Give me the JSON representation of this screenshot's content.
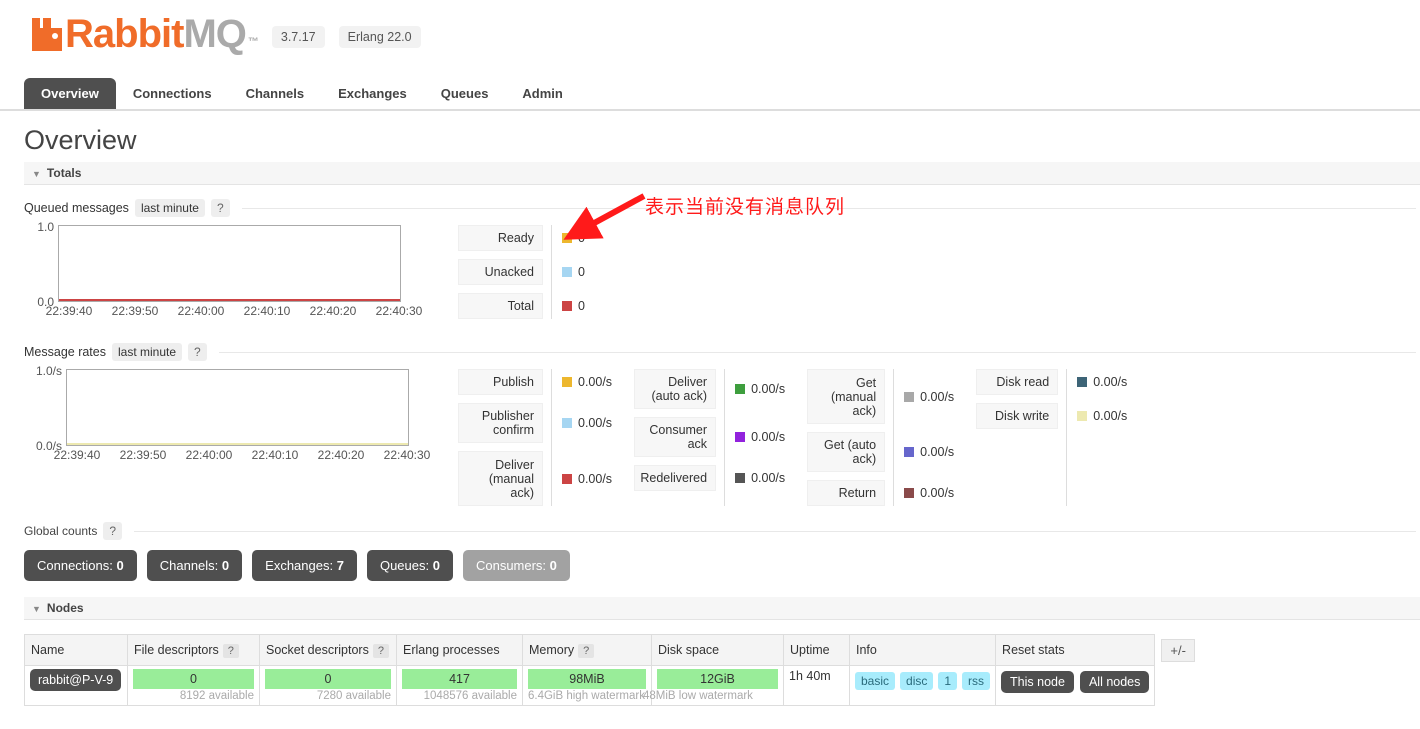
{
  "header": {
    "logo_rabbit": "Rabbit",
    "logo_mq": "MQ",
    "trademark": "™",
    "version": "3.7.17",
    "erlang": "Erlang 22.0"
  },
  "nav": {
    "tabs": [
      {
        "label": "Overview",
        "active": true
      },
      {
        "label": "Connections",
        "active": false
      },
      {
        "label": "Channels",
        "active": false
      },
      {
        "label": "Exchanges",
        "active": false
      },
      {
        "label": "Queues",
        "active": false
      },
      {
        "label": "Admin",
        "active": false
      }
    ]
  },
  "page": {
    "title": "Overview"
  },
  "totals": {
    "section_label": "Totals",
    "queued": {
      "label": "Queued messages",
      "period": "last minute",
      "help": "?",
      "y_top": "1.0",
      "y_bottom": "0.0",
      "x_ticks": [
        "22:39:40",
        "22:39:50",
        "22:40:00",
        "22:40:10",
        "22:40:20",
        "22:40:30"
      ],
      "legend": [
        {
          "name": "Ready",
          "value": "0",
          "color": "#edb72e"
        },
        {
          "name": "Unacked",
          "value": "0",
          "color": "#a6d6f2"
        },
        {
          "name": "Total",
          "value": "0",
          "color": "#cc4444"
        }
      ]
    },
    "rates": {
      "label": "Message rates",
      "period": "last minute",
      "help": "?",
      "y_top": "1.0/s",
      "y_bottom": "0.0/s",
      "x_ticks": [
        "22:39:40",
        "22:39:50",
        "22:40:00",
        "22:40:10",
        "22:40:20",
        "22:40:30"
      ],
      "groups": [
        [
          {
            "name": "Publish",
            "value": "0.00/s",
            "color": "#edb72e"
          },
          {
            "name": "Publisher confirm",
            "value": "0.00/s",
            "color": "#a6d6f2"
          },
          {
            "name": "Deliver (manual ack)",
            "value": "0.00/s",
            "color": "#cc4444"
          }
        ],
        [
          {
            "name": "Deliver (auto ack)",
            "value": "0.00/s",
            "color": "#3e9e3e"
          },
          {
            "name": "Consumer ack",
            "value": "0.00/s",
            "color": "#9222dd"
          },
          {
            "name": "Redelivered",
            "value": "0.00/s",
            "color": "#555555"
          }
        ],
        [
          {
            "name": "Get (manual ack)",
            "value": "0.00/s",
            "color": "#a8a8a8"
          },
          {
            "name": "Get (auto ack)",
            "value": "0.00/s",
            "color": "#6666cc"
          },
          {
            "name": "Return",
            "value": "0.00/s",
            "color": "#8a4a4a"
          }
        ],
        [
          {
            "name": "Disk read",
            "value": "0.00/s",
            "color": "#3d6477"
          },
          {
            "name": "Disk write",
            "value": "0.00/s",
            "color": "#ede9b0"
          }
        ]
      ]
    }
  },
  "global_counts": {
    "label": "Global counts",
    "help": "?",
    "buttons": [
      {
        "label": "Connections:",
        "value": "0",
        "muted": false
      },
      {
        "label": "Channels:",
        "value": "0",
        "muted": false
      },
      {
        "label": "Exchanges:",
        "value": "7",
        "muted": false
      },
      {
        "label": "Queues:",
        "value": "0",
        "muted": false
      },
      {
        "label": "Consumers:",
        "value": "0",
        "muted": true
      }
    ]
  },
  "nodes": {
    "section_label": "Nodes",
    "columns": [
      {
        "label": "Name",
        "help": ""
      },
      {
        "label": "File descriptors",
        "help": "?"
      },
      {
        "label": "Socket descriptors",
        "help": "?"
      },
      {
        "label": "Erlang processes",
        "help": ""
      },
      {
        "label": "Memory",
        "help": "?"
      },
      {
        "label": "Disk space",
        "help": ""
      },
      {
        "label": "Uptime",
        "help": ""
      },
      {
        "label": "Info",
        "help": ""
      },
      {
        "label": "Reset stats",
        "help": ""
      },
      {
        "label": "+/-",
        "help": ""
      }
    ],
    "row": {
      "name": "rabbit@P-V-9",
      "file_descriptors": "0",
      "file_descriptors_sub": "8192 available",
      "socket_descriptors": "0",
      "socket_descriptors_sub": "7280 available",
      "erlang_processes": "417",
      "erlang_processes_sub": "1048576 available",
      "memory": "98MiB",
      "memory_sub": "6.4GiB high watermark",
      "disk_space": "12GiB",
      "disk_space_sub": "48MiB low watermark",
      "uptime": "1h 40m",
      "info_badges": [
        "basic",
        "disc",
        "1",
        "rss"
      ],
      "reset_buttons": [
        "This node",
        "All nodes"
      ],
      "plusminus": "+/-"
    }
  },
  "annotation": {
    "text": "表示当前没有消息队列",
    "color": "#ff1a1a"
  },
  "chart_data": [
    {
      "type": "line",
      "title": "Queued messages",
      "subtitle": "last minute",
      "x": [
        "22:39:40",
        "22:39:50",
        "22:40:00",
        "22:40:10",
        "22:40:20",
        "22:40:30"
      ],
      "xlabel": "",
      "ylabel": "",
      "ylim": [
        0,
        1
      ],
      "yticks": [
        "0.0",
        "1.0"
      ],
      "grid": false,
      "legend_position": "right",
      "series": [
        {
          "name": "Ready",
          "values": [
            0,
            0,
            0,
            0,
            0,
            0
          ],
          "color": "#edb72e",
          "current": 0
        },
        {
          "name": "Unacked",
          "values": [
            0,
            0,
            0,
            0,
            0,
            0
          ],
          "color": "#a6d6f2",
          "current": 0
        },
        {
          "name": "Total",
          "values": [
            0,
            0,
            0,
            0,
            0,
            0
          ],
          "color": "#cc4444",
          "current": 0
        }
      ]
    },
    {
      "type": "line",
      "title": "Message rates",
      "subtitle": "last minute",
      "x": [
        "22:39:40",
        "22:39:50",
        "22:40:00",
        "22:40:10",
        "22:40:20",
        "22:40:30"
      ],
      "xlabel": "",
      "ylabel": "",
      "ylim": [
        0,
        1
      ],
      "yticks": [
        "0.0/s",
        "1.0/s"
      ],
      "grid": false,
      "legend_position": "right",
      "series": [
        {
          "name": "Publish",
          "values": [
            0,
            0,
            0,
            0,
            0,
            0
          ],
          "color": "#edb72e",
          "current": "0.00/s"
        },
        {
          "name": "Publisher confirm",
          "values": [
            0,
            0,
            0,
            0,
            0,
            0
          ],
          "color": "#a6d6f2",
          "current": "0.00/s"
        },
        {
          "name": "Deliver (manual ack)",
          "values": [
            0,
            0,
            0,
            0,
            0,
            0
          ],
          "color": "#cc4444",
          "current": "0.00/s"
        },
        {
          "name": "Deliver (auto ack)",
          "values": [
            0,
            0,
            0,
            0,
            0,
            0
          ],
          "color": "#3e9e3e",
          "current": "0.00/s"
        },
        {
          "name": "Consumer ack",
          "values": [
            0,
            0,
            0,
            0,
            0,
            0
          ],
          "color": "#9222dd",
          "current": "0.00/s"
        },
        {
          "name": "Redelivered",
          "values": [
            0,
            0,
            0,
            0,
            0,
            0
          ],
          "color": "#555555",
          "current": "0.00/s"
        },
        {
          "name": "Get (manual ack)",
          "values": [
            0,
            0,
            0,
            0,
            0,
            0
          ],
          "color": "#a8a8a8",
          "current": "0.00/s"
        },
        {
          "name": "Get (auto ack)",
          "values": [
            0,
            0,
            0,
            0,
            0,
            0
          ],
          "color": "#6666cc",
          "current": "0.00/s"
        },
        {
          "name": "Return",
          "values": [
            0,
            0,
            0,
            0,
            0,
            0
          ],
          "color": "#8a4a4a",
          "current": "0.00/s"
        },
        {
          "name": "Disk read",
          "values": [
            0,
            0,
            0,
            0,
            0,
            0
          ],
          "color": "#3d6477",
          "current": "0.00/s"
        },
        {
          "name": "Disk write",
          "values": [
            0,
            0,
            0,
            0,
            0,
            0
          ],
          "color": "#ede9b0",
          "current": "0.00/s"
        }
      ]
    }
  ]
}
